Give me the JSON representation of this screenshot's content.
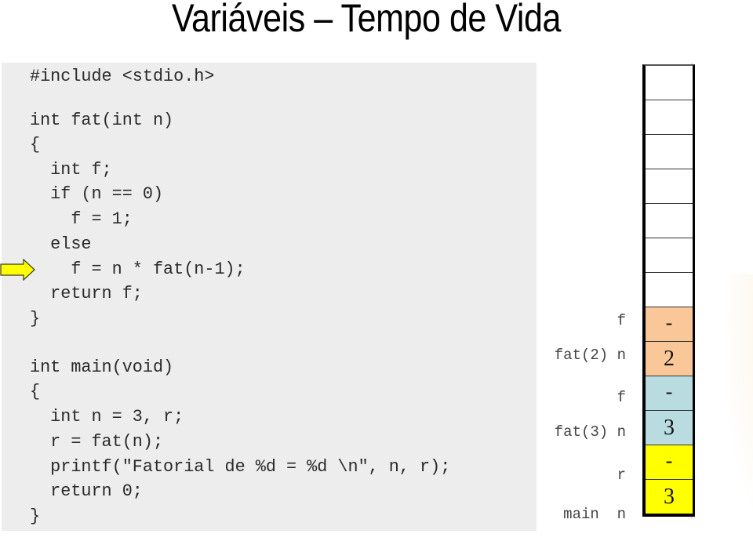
{
  "title": "Variáveis – Tempo de Vida",
  "code": {
    "lines": [
      "#include <stdio.h>",
      "int fat(int n)",
      "{",
      "  int f;",
      "  if (n == 0)",
      "    f = 1;",
      "  else",
      "    f = n * fat(n-1);",
      "  return f;",
      "}",
      "int main(void)",
      "{",
      "  int n = 3, r;",
      "  r = fat(n);",
      "  printf(\"Fatorial de %d = %d \\n\", n, r);",
      "  return 0;",
      "}"
    ],
    "current_line_index": 7,
    "current_line_marker": "arrow-right-icon"
  },
  "stack": {
    "empty_cells": 7,
    "cells": [
      {
        "value": "-",
        "label": "f",
        "frame": "fat(2)",
        "color": "#fac898"
      },
      {
        "value": "2",
        "label": "fat(2) n",
        "frame": "fat(2)",
        "color": "#fac898"
      },
      {
        "value": "-",
        "label": "f",
        "frame": "fat(3)",
        "color": "#b8dce0"
      },
      {
        "value": "3",
        "label": "fat(3) n",
        "frame": "fat(3)",
        "color": "#b8dce0"
      },
      {
        "value": "-",
        "label": "r",
        "frame": "main",
        "color": "#ffff00"
      },
      {
        "value": "3",
        "label": "main  n",
        "frame": "main",
        "color": "#ffff00"
      }
    ]
  },
  "colors": {
    "code_background": "#ededed",
    "arrow_fill": "#ffff00",
    "fat2_frame": "#fac898",
    "fat3_frame": "#b8dce0",
    "main_frame": "#ffff00"
  }
}
